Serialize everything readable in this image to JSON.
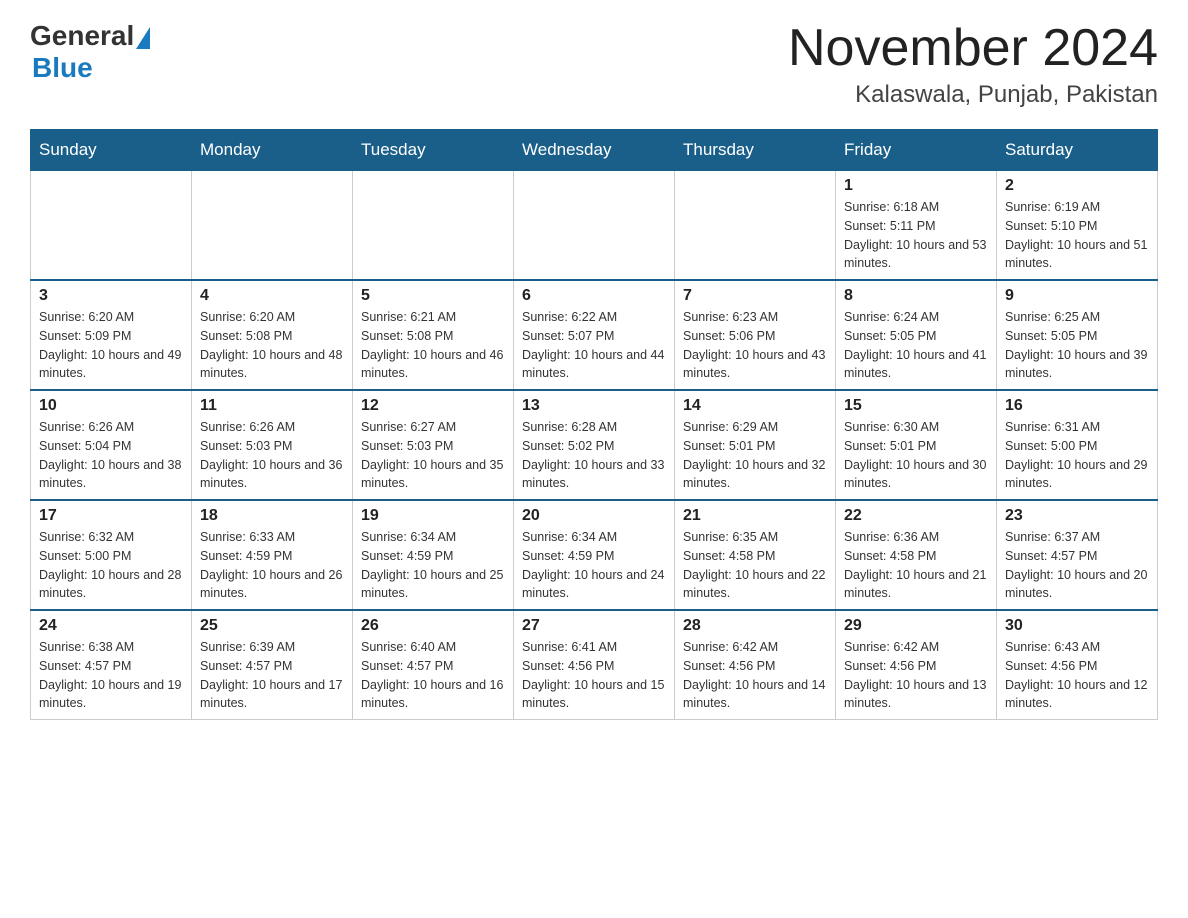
{
  "header": {
    "logo_general": "General",
    "logo_blue": "Blue",
    "month_title": "November 2024",
    "location": "Kalaswala, Punjab, Pakistan"
  },
  "days_of_week": [
    "Sunday",
    "Monday",
    "Tuesday",
    "Wednesday",
    "Thursday",
    "Friday",
    "Saturday"
  ],
  "weeks": [
    [
      {
        "day": "",
        "info": ""
      },
      {
        "day": "",
        "info": ""
      },
      {
        "day": "",
        "info": ""
      },
      {
        "day": "",
        "info": ""
      },
      {
        "day": "",
        "info": ""
      },
      {
        "day": "1",
        "info": "Sunrise: 6:18 AM\nSunset: 5:11 PM\nDaylight: 10 hours and 53 minutes."
      },
      {
        "day": "2",
        "info": "Sunrise: 6:19 AM\nSunset: 5:10 PM\nDaylight: 10 hours and 51 minutes."
      }
    ],
    [
      {
        "day": "3",
        "info": "Sunrise: 6:20 AM\nSunset: 5:09 PM\nDaylight: 10 hours and 49 minutes."
      },
      {
        "day": "4",
        "info": "Sunrise: 6:20 AM\nSunset: 5:08 PM\nDaylight: 10 hours and 48 minutes."
      },
      {
        "day": "5",
        "info": "Sunrise: 6:21 AM\nSunset: 5:08 PM\nDaylight: 10 hours and 46 minutes."
      },
      {
        "day": "6",
        "info": "Sunrise: 6:22 AM\nSunset: 5:07 PM\nDaylight: 10 hours and 44 minutes."
      },
      {
        "day": "7",
        "info": "Sunrise: 6:23 AM\nSunset: 5:06 PM\nDaylight: 10 hours and 43 minutes."
      },
      {
        "day": "8",
        "info": "Sunrise: 6:24 AM\nSunset: 5:05 PM\nDaylight: 10 hours and 41 minutes."
      },
      {
        "day": "9",
        "info": "Sunrise: 6:25 AM\nSunset: 5:05 PM\nDaylight: 10 hours and 39 minutes."
      }
    ],
    [
      {
        "day": "10",
        "info": "Sunrise: 6:26 AM\nSunset: 5:04 PM\nDaylight: 10 hours and 38 minutes."
      },
      {
        "day": "11",
        "info": "Sunrise: 6:26 AM\nSunset: 5:03 PM\nDaylight: 10 hours and 36 minutes."
      },
      {
        "day": "12",
        "info": "Sunrise: 6:27 AM\nSunset: 5:03 PM\nDaylight: 10 hours and 35 minutes."
      },
      {
        "day": "13",
        "info": "Sunrise: 6:28 AM\nSunset: 5:02 PM\nDaylight: 10 hours and 33 minutes."
      },
      {
        "day": "14",
        "info": "Sunrise: 6:29 AM\nSunset: 5:01 PM\nDaylight: 10 hours and 32 minutes."
      },
      {
        "day": "15",
        "info": "Sunrise: 6:30 AM\nSunset: 5:01 PM\nDaylight: 10 hours and 30 minutes."
      },
      {
        "day": "16",
        "info": "Sunrise: 6:31 AM\nSunset: 5:00 PM\nDaylight: 10 hours and 29 minutes."
      }
    ],
    [
      {
        "day": "17",
        "info": "Sunrise: 6:32 AM\nSunset: 5:00 PM\nDaylight: 10 hours and 28 minutes."
      },
      {
        "day": "18",
        "info": "Sunrise: 6:33 AM\nSunset: 4:59 PM\nDaylight: 10 hours and 26 minutes."
      },
      {
        "day": "19",
        "info": "Sunrise: 6:34 AM\nSunset: 4:59 PM\nDaylight: 10 hours and 25 minutes."
      },
      {
        "day": "20",
        "info": "Sunrise: 6:34 AM\nSunset: 4:59 PM\nDaylight: 10 hours and 24 minutes."
      },
      {
        "day": "21",
        "info": "Sunrise: 6:35 AM\nSunset: 4:58 PM\nDaylight: 10 hours and 22 minutes."
      },
      {
        "day": "22",
        "info": "Sunrise: 6:36 AM\nSunset: 4:58 PM\nDaylight: 10 hours and 21 minutes."
      },
      {
        "day": "23",
        "info": "Sunrise: 6:37 AM\nSunset: 4:57 PM\nDaylight: 10 hours and 20 minutes."
      }
    ],
    [
      {
        "day": "24",
        "info": "Sunrise: 6:38 AM\nSunset: 4:57 PM\nDaylight: 10 hours and 19 minutes."
      },
      {
        "day": "25",
        "info": "Sunrise: 6:39 AM\nSunset: 4:57 PM\nDaylight: 10 hours and 17 minutes."
      },
      {
        "day": "26",
        "info": "Sunrise: 6:40 AM\nSunset: 4:57 PM\nDaylight: 10 hours and 16 minutes."
      },
      {
        "day": "27",
        "info": "Sunrise: 6:41 AM\nSunset: 4:56 PM\nDaylight: 10 hours and 15 minutes."
      },
      {
        "day": "28",
        "info": "Sunrise: 6:42 AM\nSunset: 4:56 PM\nDaylight: 10 hours and 14 minutes."
      },
      {
        "day": "29",
        "info": "Sunrise: 6:42 AM\nSunset: 4:56 PM\nDaylight: 10 hours and 13 minutes."
      },
      {
        "day": "30",
        "info": "Sunrise: 6:43 AM\nSunset: 4:56 PM\nDaylight: 10 hours and 12 minutes."
      }
    ]
  ]
}
